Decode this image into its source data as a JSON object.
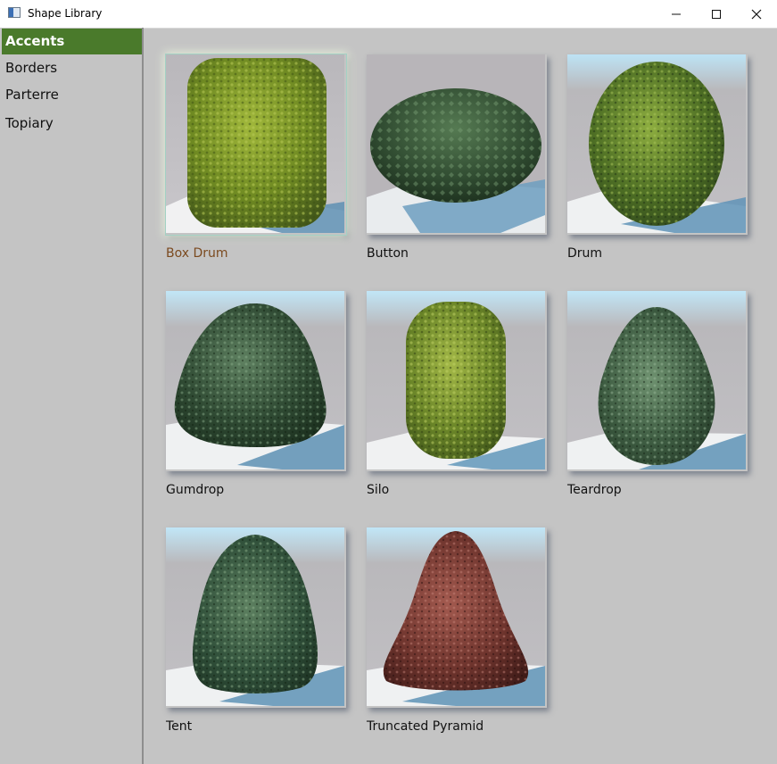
{
  "window": {
    "title": "Shape Library",
    "minimize_icon": "minimize-icon",
    "maximize_icon": "maximize-icon",
    "close_icon": "close-icon"
  },
  "sidebar": {
    "items": [
      {
        "label": "Accents",
        "active": true
      },
      {
        "label": "Borders",
        "active": false
      },
      {
        "label": "Parterre",
        "active": false
      },
      {
        "label": "Topiary",
        "active": false
      }
    ]
  },
  "shapes": [
    {
      "label": "Box Drum",
      "selected": true
    },
    {
      "label": "Button",
      "selected": false
    },
    {
      "label": "Drum",
      "selected": false
    },
    {
      "label": "Gumdrop",
      "selected": false
    },
    {
      "label": "Silo",
      "selected": false
    },
    {
      "label": "Teardrop",
      "selected": false
    },
    {
      "label": "Tent",
      "selected": false
    },
    {
      "label": "Truncated Pyramid",
      "selected": false
    }
  ],
  "colors": {
    "accent": "#4a7a2b",
    "selected_caption": "#7b4a1f",
    "foliage_light": "#7b9a2a",
    "foliage_dark": "#2f4a30",
    "foliage_red": "#7a3a32"
  }
}
